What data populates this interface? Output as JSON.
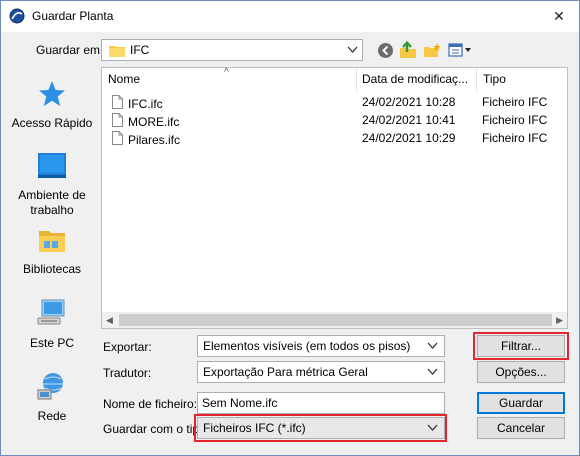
{
  "window": {
    "title": "Guardar Planta",
    "close_glyph": "✕"
  },
  "toolbar": {
    "save_in_label": "Guardar em:",
    "current_folder": "IFC",
    "back_icon": "back-icon",
    "up_icon": "up-folder-icon",
    "new_folder_icon": "new-folder-icon",
    "view_icon": "view-menu-icon"
  },
  "places": [
    {
      "label": "Acesso Rápido",
      "icon": "star-icon"
    },
    {
      "label": "Ambiente de trabalho",
      "icon": "desktop-icon"
    },
    {
      "label": "Bibliotecas",
      "icon": "libraries-icon"
    },
    {
      "label": "Este PC",
      "icon": "pc-icon"
    },
    {
      "label": "Rede",
      "icon": "network-icon"
    }
  ],
  "filelist": {
    "columns": {
      "name": "Nome",
      "date": "Data de modificaç...",
      "type": "Tipo"
    },
    "rows": [
      {
        "name": "IFC.ifc",
        "date": "24/02/2021 10:28",
        "type": "Ficheiro IFC"
      },
      {
        "name": "MORE.ifc",
        "date": "24/02/2021 10:41",
        "type": "Ficheiro IFC"
      },
      {
        "name": "Pilares.ifc",
        "date": "24/02/2021 10:29",
        "type": "Ficheiro IFC"
      }
    ]
  },
  "form": {
    "export_label": "Exportar:",
    "export_value": "Elementos visíveis (em todos os pisos)",
    "translator_label": "Tradutor:",
    "translator_value": "Exportação Para métrica Geral",
    "filename_label": "Nome de ficheiro:",
    "filename_value": "Sem Nome.ifc",
    "filetype_label": "Guardar com o tipo:",
    "filetype_value": "Ficheiros IFC (*.ifc)"
  },
  "buttons": {
    "filter": "Filtrar...",
    "options": "Opções...",
    "save": "Guardar",
    "cancel": "Cancelar"
  },
  "colors": {
    "highlight": "#e3262e",
    "accent": "#0078d7"
  }
}
